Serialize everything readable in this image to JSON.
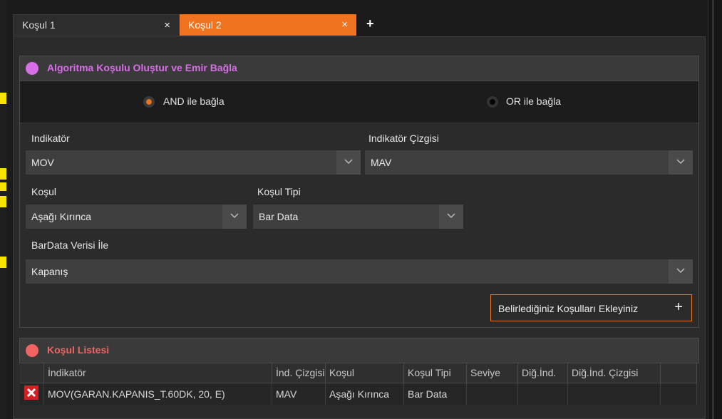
{
  "tabs": [
    {
      "label": "Koşul 1",
      "close": "×"
    },
    {
      "label": "Koşul 2",
      "close": "×"
    }
  ],
  "tab_add": "+",
  "panel": {
    "title": "Algoritma Koşulu Oluştur ve Emir Bağla",
    "title_color": "#d86ee8",
    "radio_and": "AND ile bağla",
    "radio_or": "OR ile bağla",
    "selected_radio": "AND",
    "fields": {
      "indikator_label": "Indikatör",
      "indikator_value": "MOV",
      "cizgi_label": "Indikatör Çizgisi",
      "cizgi_value": "MAV",
      "kosul_label": "Koşul",
      "kosul_value": "Aşağı Kırınca",
      "tipi_label": "Koşul Tipi",
      "tipi_value": "Bar Data",
      "bardata_label": "BarData Verisi İle",
      "bardata_value": "Kapanış"
    },
    "add_button": "Belirlediğiniz Koşulları Ekleyiniz",
    "add_icon": "+"
  },
  "list": {
    "title": "Koşul Listesi",
    "title_color": "#f06464",
    "columns": [
      "İndikatör",
      "İnd. Çizgisi",
      "Koşul",
      "Koşul Tipi",
      "Seviye",
      "Diğ.İnd.",
      "Diğ.İnd. Çizgisi"
    ],
    "rows": [
      [
        "MOV(GARAN.KAPANIS_T.60DK, 20, E)",
        "MAV",
        "Aşağı Kırınca",
        "Bar Data",
        "",
        "",
        ""
      ]
    ]
  },
  "colors": {
    "accent": "#f0741f",
    "delete": "#d42020"
  }
}
